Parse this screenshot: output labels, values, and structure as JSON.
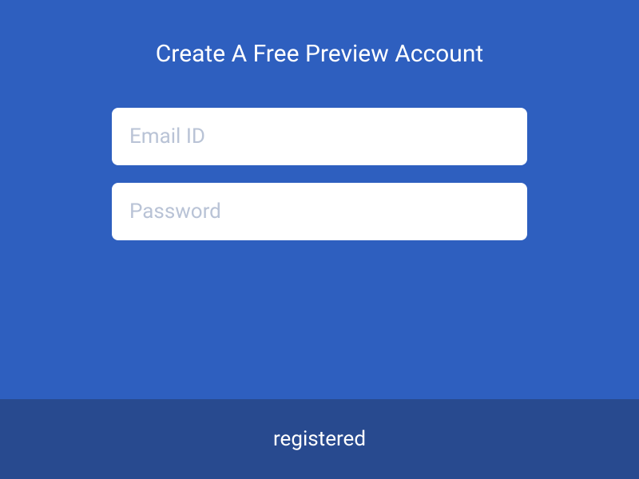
{
  "title": "Create A Free Preview Account",
  "form": {
    "email": {
      "placeholder": "Email ID",
      "value": ""
    },
    "password": {
      "placeholder": "Password",
      "value": ""
    }
  },
  "bottom": {
    "label": "registered"
  }
}
